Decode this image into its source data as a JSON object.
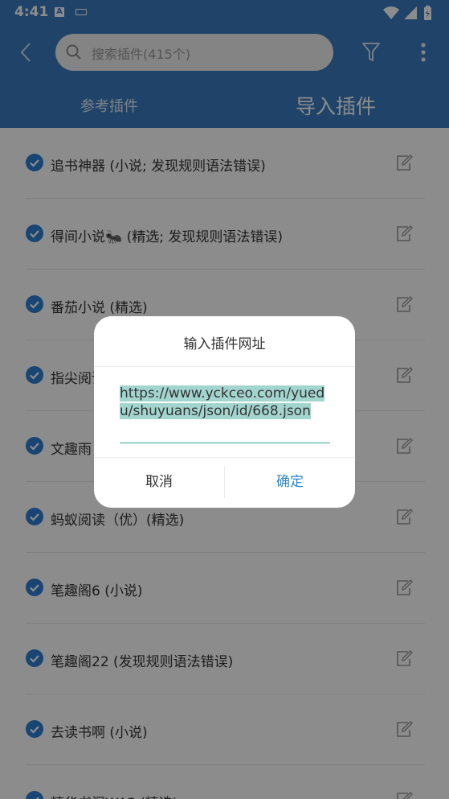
{
  "status_bar": {
    "time": "4:41",
    "a_badge": "A"
  },
  "header": {
    "search_placeholder": "搜索插件(415个)",
    "tabs": [
      {
        "label": "参考插件"
      },
      {
        "label": "导入插件"
      }
    ]
  },
  "plugins": [
    {
      "label": "追书神器 (小说; 发现规则语法错误)"
    },
    {
      "label": "得间小说🐜 (精选; 发现规则语法错误)"
    },
    {
      "label": "番茄小说 (精选)"
    },
    {
      "label": "指尖阅读"
    },
    {
      "label": "文趣雨"
    },
    {
      "label": "蚂蚁阅读（优）(精选)"
    },
    {
      "label": "笔趣阁6 (小说)"
    },
    {
      "label": "笔趣阁22 (发现规则语法错误)"
    },
    {
      "label": "去读书啊 (小说)"
    },
    {
      "label": "精华书阁WAP (精选)"
    }
  ],
  "dialog": {
    "title": "输入插件网址",
    "url": "https://www.yckceo.com/yuedu/shuyuans/json/id/668.json",
    "cancel": "取消",
    "ok": "确定"
  },
  "colors": {
    "primary": "#3b7cc0",
    "accent": "#2d86c8",
    "check": "#2d7fd1"
  }
}
